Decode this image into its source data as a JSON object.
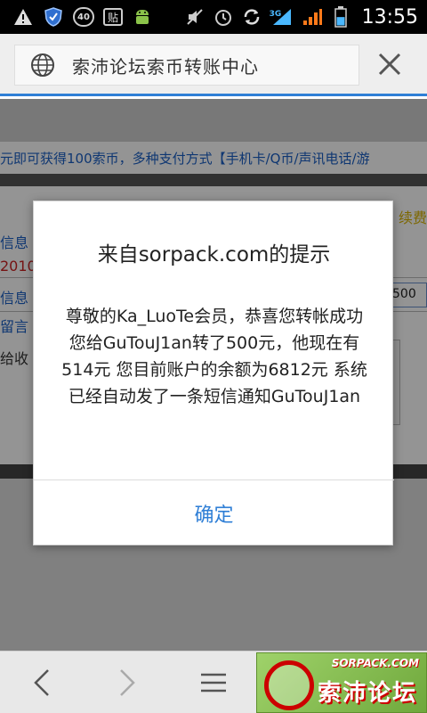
{
  "status_bar": {
    "badge_number": "40",
    "tie_glyph": "贴",
    "network_label": "3G",
    "time": "13:55",
    "battery_level": 0.55,
    "icons": [
      "warning-icon",
      "shield-icon",
      "android-icon",
      "mute-icon",
      "alarm-icon",
      "sync-icon",
      "signal-3g-icon",
      "signal-icon",
      "battery-icon"
    ]
  },
  "browser": {
    "title": "索沛论坛索币转账中心",
    "accent_color": "#2f7fd6"
  },
  "page": {
    "promo_text": "元即可获得100索币，多种支付方式【手机卡/Q币/声讯电话/游",
    "fee_text": "续费",
    "label_1": "信息",
    "red_text": "2010",
    "label_2": "信息",
    "amount_value": "500",
    "label_3": "留言",
    "gray_text": "给收"
  },
  "dialog": {
    "title": "来自sorpack.com的提示",
    "message": "尊敬的Ka_LuoTe会员，恭喜您转帐成功 您给GuTouJ1an转了500元，他现在有514元 您目前账户的余额为6812元 系统已经自动发了一条短信通知GuTouJ1an",
    "ok_label": "确定"
  },
  "watermark": {
    "url_text": "SORPACK.COM",
    "chinese_text": "索沛论坛"
  }
}
